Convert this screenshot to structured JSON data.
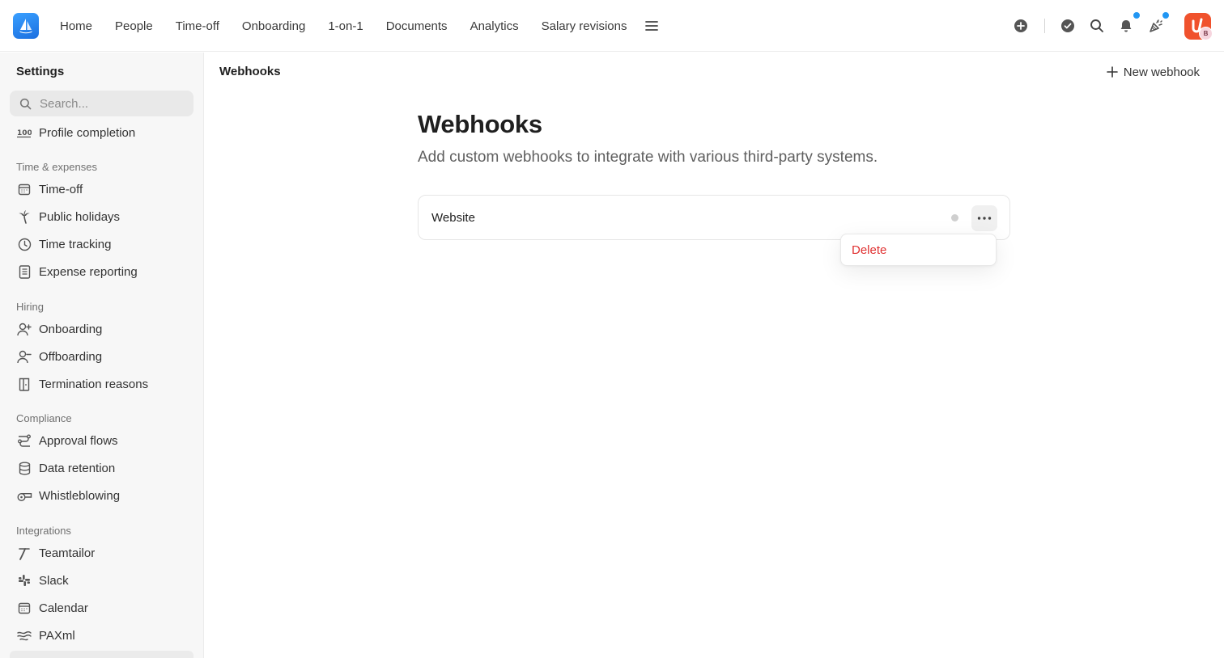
{
  "nav": {
    "items": [
      "Home",
      "People",
      "Time-off",
      "Onboarding",
      "1-on-1",
      "Documents",
      "Analytics",
      "Salary revisions"
    ]
  },
  "avatar": {
    "initial": "B"
  },
  "sidebar": {
    "title": "Settings",
    "search_placeholder": "Search...",
    "profile_completion": "Profile completion",
    "sections": {
      "time_expenses": "Time & expenses",
      "hiring": "Hiring",
      "compliance": "Compliance",
      "integrations": "Integrations"
    },
    "items": {
      "time_off": "Time-off",
      "public_holidays": "Public holidays",
      "time_tracking": "Time tracking",
      "expense_reporting": "Expense reporting",
      "onboarding": "Onboarding",
      "offboarding": "Offboarding",
      "termination_reasons": "Termination reasons",
      "approval_flows": "Approval flows",
      "data_retention": "Data retention",
      "whistleblowing": "Whistleblowing",
      "teamtailor": "Teamtailor",
      "slack": "Slack",
      "calendar": "Calendar",
      "paxml": "PAXml"
    }
  },
  "main": {
    "breadcrumb": "Webhooks",
    "new_button": "New webhook",
    "title": "Webhooks",
    "subtitle": "Add custom webhooks to integrate with various third-party systems.",
    "webhook": {
      "name": "Website"
    },
    "menu": {
      "delete": "Delete"
    }
  },
  "colors": {
    "accent": "#1b6fe0",
    "badge": "#2196f3",
    "danger": "#e03131",
    "avatar": "#f0522d"
  }
}
